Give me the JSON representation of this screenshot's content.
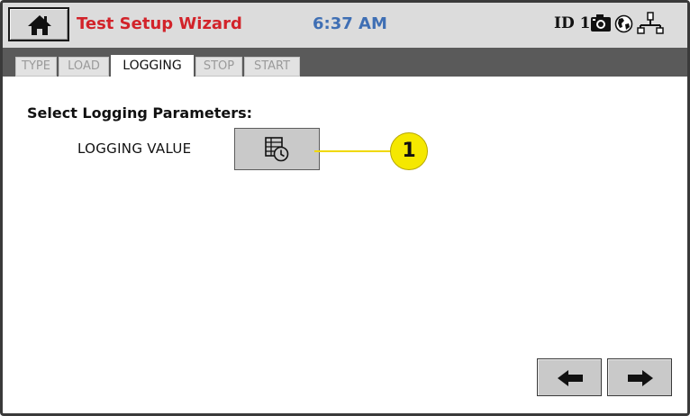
{
  "header": {
    "title": "Test Setup Wizard",
    "time": "6:37 AM",
    "id_label": "ID 1",
    "title_color": "#d2232a",
    "time_color": "#3f6fb4",
    "icons": [
      "home-icon",
      "camera-icon",
      "globe-icon",
      "network-icon"
    ]
  },
  "tabs": [
    {
      "label": "TYPE",
      "active": false
    },
    {
      "label": "LOAD",
      "active": false
    },
    {
      "label": "LOGGING",
      "active": true
    },
    {
      "label": "STOP",
      "active": false
    },
    {
      "label": "START",
      "active": false
    }
  ],
  "main": {
    "section_title": "Select Logging Parameters:",
    "logging_value_label": "LOGGING VALUE",
    "logging_button_icon": "table-clock-icon",
    "callout_number": "1",
    "callout_color": "#f5e800"
  },
  "nav": {
    "back_icon": "arrow-left-icon",
    "next_icon": "arrow-right-icon"
  }
}
